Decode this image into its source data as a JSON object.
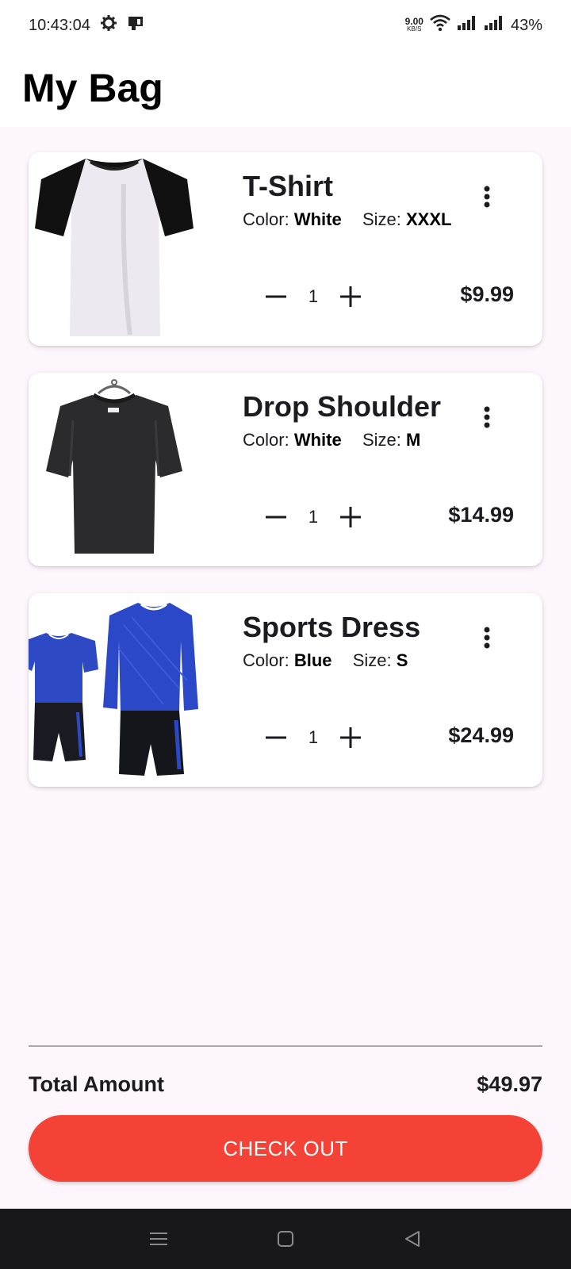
{
  "status_bar": {
    "time": "10:43:04",
    "net_speed_value": "9.00",
    "net_speed_unit": "KB/S",
    "battery": "43%"
  },
  "header": {
    "title": "My Bag"
  },
  "cart": {
    "color_label": "Color:",
    "size_label": "Size:",
    "items": [
      {
        "name": "T-Shirt",
        "color": "White",
        "size": "XXXL",
        "quantity": "1",
        "price": "$9.99"
      },
      {
        "name": "Drop Shoulder",
        "color": "White",
        "size": "M",
        "quantity": "1",
        "price": "$14.99"
      },
      {
        "name": "Sports Dress",
        "color": "Blue",
        "size": "S",
        "quantity": "1",
        "price": "$24.99"
      }
    ]
  },
  "summary": {
    "total_label": "Total Amount",
    "total_value": "$49.97",
    "checkout_label": "CHECK OUT"
  },
  "icons": [
    "settings-icon",
    "sim-icon",
    "wifi-icon",
    "signal-icon",
    "more-vert-icon",
    "minus-icon",
    "plus-icon",
    "menu-icon",
    "home-icon",
    "back-icon"
  ],
  "colors": {
    "accent": "#f44336",
    "background": "#fdf6fc",
    "card": "#ffffff",
    "nav_bar": "#18171a"
  }
}
